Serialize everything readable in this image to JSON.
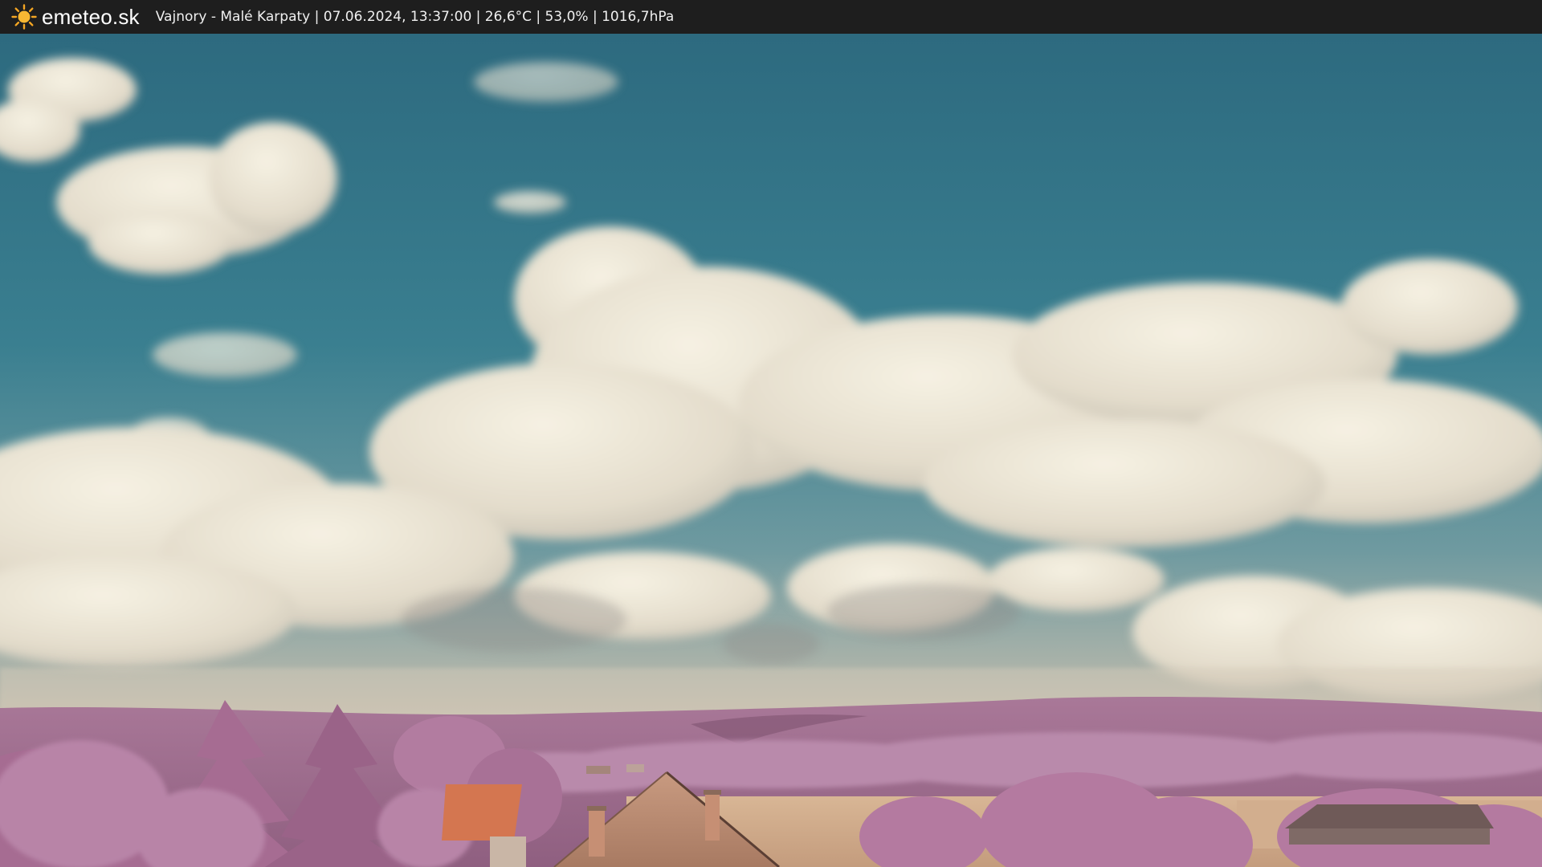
{
  "header": {
    "logo_icon": "sun-icon",
    "brand": "emeteo.sk",
    "caption": "Vajnory - Malé Karpaty | 07.06.2024, 13:37:00 | 26,6°C | 53,0% | 1016,7hPa"
  },
  "colors": {
    "bar": "#1e1e1e",
    "sun": "#f5a623",
    "sky": "#2f7488",
    "cloud": "#ece6d6",
    "foliage": "#b07aa0",
    "field": "#cfa98a",
    "roof": "#d97a55"
  }
}
